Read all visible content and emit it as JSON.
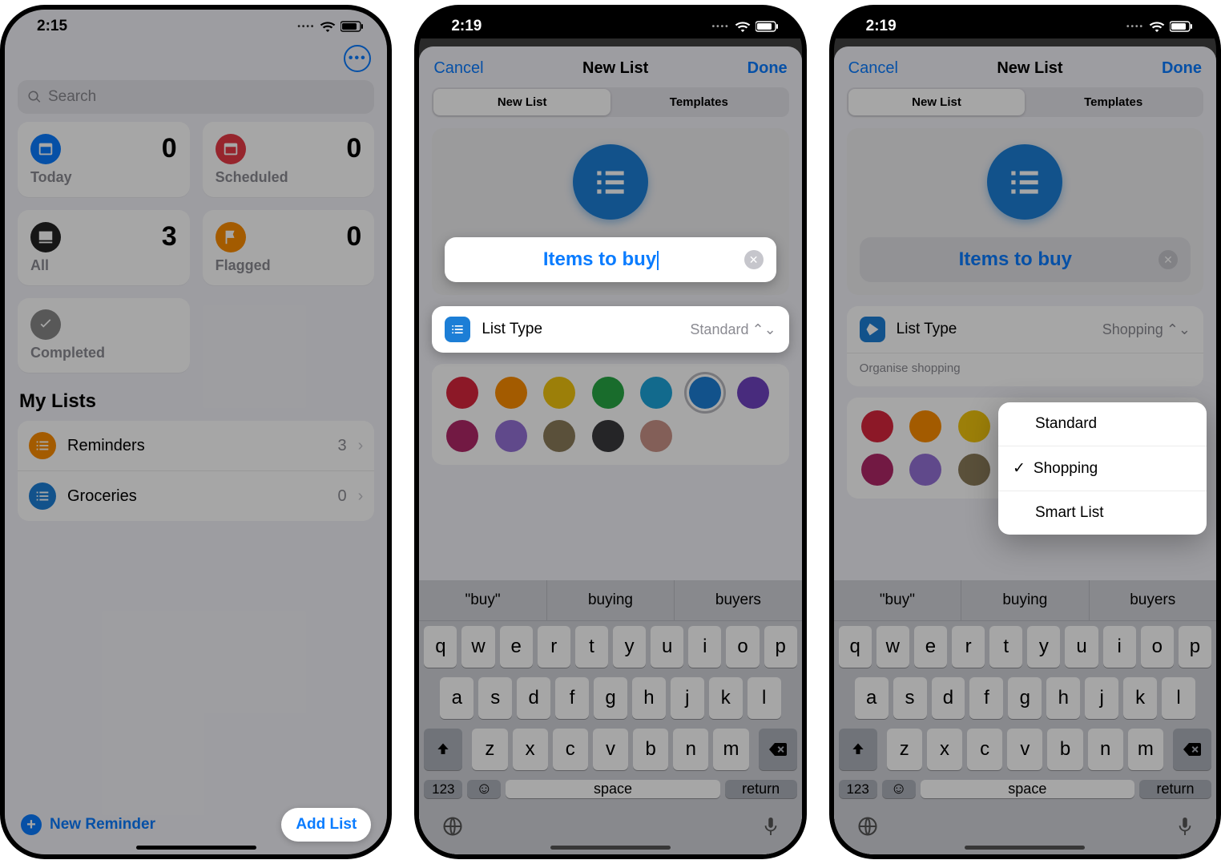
{
  "screen1": {
    "time": "2:15",
    "search_placeholder": "Search",
    "smart": [
      {
        "label": "Today",
        "count": "0",
        "color": "#0a7cff",
        "icon": "calendar"
      },
      {
        "label": "Scheduled",
        "count": "0",
        "color": "#e63946",
        "icon": "calendar"
      },
      {
        "label": "All",
        "count": "3",
        "color": "#222",
        "icon": "tray"
      },
      {
        "label": "Flagged",
        "count": "0",
        "color": "#fb8c00",
        "icon": "flag"
      },
      {
        "label": "Completed",
        "count": "",
        "color": "#888",
        "icon": "check"
      }
    ],
    "section": "My Lists",
    "lists": [
      {
        "name": "Reminders",
        "count": "3",
        "color": "#fb8c00"
      },
      {
        "name": "Groceries",
        "count": "0",
        "color": "#1c7ed6"
      }
    ],
    "new_reminder": "New Reminder",
    "add_list": "Add List"
  },
  "screen2": {
    "time": "2:19",
    "cancel": "Cancel",
    "title": "New List",
    "done": "Done",
    "seg": [
      "New List",
      "Templates"
    ],
    "seg_active": 0,
    "name_value": "Items to buy",
    "list_type_label": "List Type",
    "list_type_value": "Standard",
    "list_type_icon_color": "#1c7ed6",
    "colors": [
      "#d7263d",
      "#fb8c00",
      "#f0c40f",
      "#27a744",
      "#1ca4d9",
      "#1c7ed6",
      "#6f42c1",
      "#b02768",
      "#9470d6",
      "#8b7b5a",
      "#3a3a3c",
      "#c99387"
    ],
    "selected_color": 5,
    "suggestions": [
      "\"buy\"",
      "buying",
      "buyers"
    ],
    "keys": {
      "r1": [
        "q",
        "w",
        "e",
        "r",
        "t",
        "y",
        "u",
        "i",
        "o",
        "p"
      ],
      "r2": [
        "a",
        "s",
        "d",
        "f",
        "g",
        "h",
        "j",
        "k",
        "l"
      ],
      "r3": [
        "z",
        "x",
        "c",
        "v",
        "b",
        "n",
        "m"
      ],
      "space": "space",
      "return": "return",
      "n123": "123"
    }
  },
  "screen3": {
    "time": "2:19",
    "cancel": "Cancel",
    "title": "New List",
    "done": "Done",
    "seg": [
      "New List",
      "Templates"
    ],
    "seg_active": 0,
    "name_value": "Items to buy",
    "list_type_label": "List Type",
    "list_type_value": "Shopping",
    "list_type_icon_color": "#1c7ed6",
    "organise": "Organise shopping",
    "menu": [
      "Standard",
      "Shopping",
      "Smart List"
    ],
    "menu_selected": 1,
    "colors": [
      "#d7263d",
      "#fb8c00",
      "#f0c40f",
      "#27a744",
      "#1ca4d9",
      "#1c7ed6",
      "#6f42c1",
      "#b02768",
      "#9470d6",
      "#8b7b5a",
      "#3a3a3c",
      "#c99387"
    ],
    "suggestions": [
      "\"buy\"",
      "buying",
      "buyers"
    ],
    "keys": {
      "r1": [
        "q",
        "w",
        "e",
        "r",
        "t",
        "y",
        "u",
        "i",
        "o",
        "p"
      ],
      "r2": [
        "a",
        "s",
        "d",
        "f",
        "g",
        "h",
        "j",
        "k",
        "l"
      ],
      "r3": [
        "z",
        "x",
        "c",
        "v",
        "b",
        "n",
        "m"
      ],
      "space": "space",
      "return": "return",
      "n123": "123"
    }
  }
}
